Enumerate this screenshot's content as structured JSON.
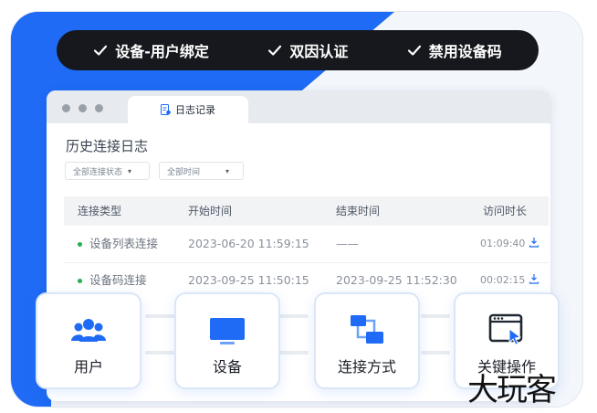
{
  "features": [
    "设备-用户绑定",
    "双因认证",
    "禁用设备码"
  ],
  "window": {
    "tab_label": "日志记录",
    "page_title": "历史连接日志",
    "filters": [
      "全部连接状态",
      "全部时间"
    ],
    "columns": [
      "连接类型",
      "开始时间",
      "结束时间",
      "访问时长"
    ],
    "rows": [
      {
        "type": "设备列表连接",
        "start": "2023-06-20 11:59:15",
        "end": "——",
        "duration": "01:09:40"
      },
      {
        "type": "设备码连接",
        "start": "2023-09-25 11:50:15",
        "end": "2023-09-25 11:52:30",
        "duration": "00:02:15"
      }
    ]
  },
  "cards": [
    {
      "label": "用户",
      "icon": "users-icon"
    },
    {
      "label": "设备",
      "icon": "monitor-icon"
    },
    {
      "label": "连接方式",
      "icon": "network-icon"
    },
    {
      "label": "关键操作",
      "icon": "cursor-window-icon"
    }
  ],
  "watermark": "大玩客",
  "colors": {
    "accent": "#1f6bf5",
    "pill": "#16181d",
    "status_green": "#22b14c"
  }
}
